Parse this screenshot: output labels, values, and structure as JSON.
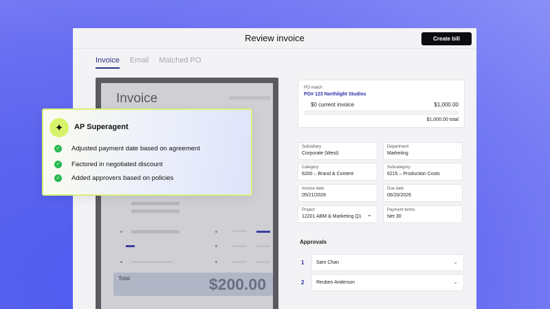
{
  "window": {
    "title": "Review invoice",
    "create_bill": "Create bill"
  },
  "tabs": [
    {
      "label": "Invoice"
    },
    {
      "label": "Email"
    },
    {
      "label": "Matched PO"
    }
  ],
  "invoice_doc": {
    "title": "Invoice",
    "total_label": "Total",
    "total_amount": "$200.00"
  },
  "po_match": {
    "label": "PO match",
    "po_link": "PO# 123 Northlight Studios",
    "current_label": "$0 current invoice",
    "current_value": "$1,000.00",
    "progress": 0,
    "total": "$1,000.00 total"
  },
  "fields": [
    {
      "label": "Subsidiary",
      "value": "Corporate (West)"
    },
    {
      "label": "Department",
      "value": "Marketing"
    },
    {
      "label": "Category",
      "value": "6200 – Brand & Content"
    },
    {
      "label": "Subcategory",
      "value": "6215 – Production Costs"
    },
    {
      "label": "Invoice date",
      "value": "05/21/2026"
    },
    {
      "label": "Due date",
      "value": "06/20/2026"
    },
    {
      "label": "Project",
      "value": "12201 ABM & Marketing Q1"
    },
    {
      "label": "Payment terms",
      "value": "Net 30"
    }
  ],
  "approvals": {
    "heading": "Approvals",
    "items": [
      {
        "num": "1",
        "name": "Sam Chan"
      },
      {
        "num": "2",
        "name": "Reuben Anderson"
      }
    ]
  },
  "agent": {
    "icon": "sparkle-icon",
    "title": "AP Superagent",
    "items": [
      {
        "text": "Adjusted payment date based on agreement"
      },
      {
        "text": "Factored in negotiated discount"
      },
      {
        "text": "Added approvers based on policies"
      }
    ]
  },
  "colors": {
    "accent": "#2c2f86",
    "agent_highlight": "#d7f36a",
    "check": "#27b84f",
    "background": "#5b64ee"
  }
}
